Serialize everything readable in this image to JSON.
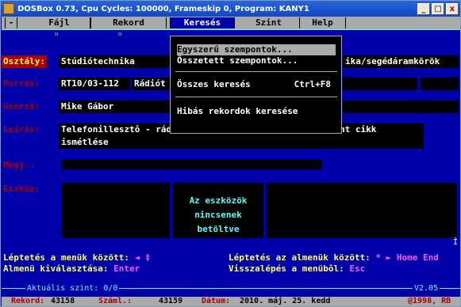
{
  "window": {
    "title": "DOSBox 0.73, Cpu Cycles:   100000, Frameskip  0, Program:    KANY1",
    "minimize_label": "_",
    "maximize_label": "□",
    "close_label": "x"
  },
  "menubar": {
    "items": [
      {
        "label": "-"
      },
      {
        "label": "Fájl"
      },
      {
        "label": "Rekord"
      },
      {
        "label": "Keresés"
      },
      {
        "label": "Szint"
      },
      {
        "label": "Help"
      }
    ]
  },
  "ruler": {
    "mark": "¤"
  },
  "dropdown": {
    "items": [
      {
        "label": "Egyszerű szempontok...",
        "shortcut": ""
      },
      {
        "label": "Összetett szempontok...",
        "shortcut": ""
      },
      {
        "label": "Összes keresés",
        "shortcut": "Ctrl+F8"
      },
      {
        "label": "Hibás rekordok keresése",
        "shortcut": ""
      }
    ]
  },
  "form": {
    "osztaly": {
      "label": "Osztály:",
      "value": "Stúdiótechnika",
      "value2": "ika/segédáramkörök"
    },
    "forras": {
      "label": "Forrás:",
      "value": "RT10/03-112",
      "value2": "Rádiót"
    },
    "szerzo": {
      "label": "Szerzô:",
      "value": "Mike Gábor"
    },
    "leiras": {
      "label": "Leírás:",
      "value": "Telefonillesztô - rádióstúdióba. A 2000/3-ban megjelent cikk ismétlése"
    },
    "megj": {
      "label": "Megj.:",
      "value": ""
    },
    "eszkoz": {
      "label": "Eszköz:",
      "box_text": "Az  eszközök nincsenek betöltve"
    }
  },
  "hints": {
    "left1_text": "Léptetés a menük között:",
    "left1_key": "◄ ‡",
    "left2_text": "Almenü kiválasztása:",
    "left2_key": "Enter",
    "right1_text": "Léptetés az almenük között:",
    "right1_key": "* ► Home End",
    "right2_text": "Visszalépés a menübôl:",
    "right2_key": "Esc"
  },
  "status": {
    "level": "Aktuális szint: 0/0",
    "version": "V2.05"
  },
  "footer": {
    "rekord_label": "Rekord:",
    "rekord_value": "43158",
    "szaml_label": "Száml.:",
    "szaml_value": "43159",
    "datum_label": "Dátum:",
    "datum_value": "2010. máj. 25. kedd",
    "copyright": "@1998, RB"
  }
}
